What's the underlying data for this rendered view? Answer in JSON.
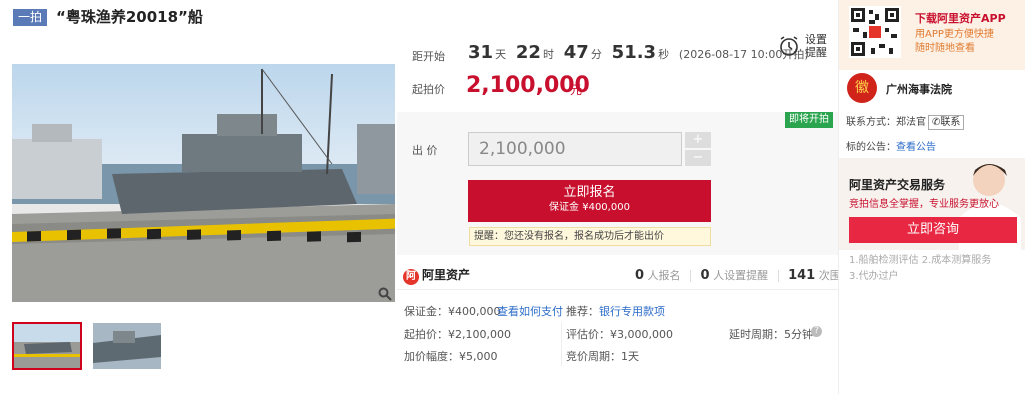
{
  "title": {
    "tag": "一拍",
    "text": "“粤珠渔养20018”船"
  },
  "countdown": {
    "label": "距开始",
    "days": "31",
    "days_unit": "天",
    "hours": "22",
    "hours_unit": "时",
    "minutes": "47",
    "minutes_unit": "分",
    "seconds": "51.3",
    "seconds_unit": "秒",
    "start_note": "(2026-08-17 10:00开拍)"
  },
  "reminder": {
    "line1": "设置",
    "line2": "提醒"
  },
  "start_price": {
    "label": "起拍价",
    "value": "2,100,000",
    "unit": "元"
  },
  "status_badge": "即将开拍",
  "bid": {
    "label": "出 价",
    "value": "2,100,000",
    "plus": "+",
    "minus": "−"
  },
  "signup_button": {
    "label": "立即报名",
    "deposit": "保证金 ¥400,000"
  },
  "tip": "提醒：您还没有报名，报名成功后才能出价",
  "platform": {
    "name": "阿里资产",
    "logo": "阿"
  },
  "stats": {
    "registered": "0",
    "registered_label": "人报名",
    "reminders": "0",
    "reminders_label": "人设置提醒",
    "views": "141",
    "views_label": "次围观"
  },
  "details": {
    "deposit": "保证金：¥400,000",
    "pay_link": "查看如何支付",
    "recommend_label": "推荐：",
    "recommend_link": "银行专用款项",
    "start_price": "起拍价：¥2,100,000",
    "appraisal": "评估价：¥3,000,000",
    "delay_period": "延时周期：5分钟",
    "increment": "加价幅度：¥5,000",
    "bid_period": "竞价周期：1天"
  },
  "app_promo": {
    "title": "下载阿里资产APP",
    "line1": "用APP更方便快捷",
    "line2": "随时随地查看"
  },
  "court": {
    "name": "广州海事法院",
    "logo": "徽"
  },
  "contact": {
    "label": "联系方式：郑法官",
    "button": "联系"
  },
  "notice": {
    "label": "标的公告：",
    "link": "查看公告"
  },
  "service": {
    "title": "阿里资产交易服务",
    "subtitle": "竞拍信息全掌握，专业服务更放心",
    "button": "立即咨询",
    "items_line1": "1.船舶检测评估  2.成本测算服务",
    "items_line2": "3.代办过户"
  },
  "icons": {
    "zoom": "search-icon",
    "alarm": "alarm-clock-icon",
    "phone": "phone-icon",
    "help": "question-icon"
  },
  "colors": {
    "accent": "#c8102e",
    "badge_green": "#2aa44f",
    "tag_blue": "#5b7bb8"
  }
}
